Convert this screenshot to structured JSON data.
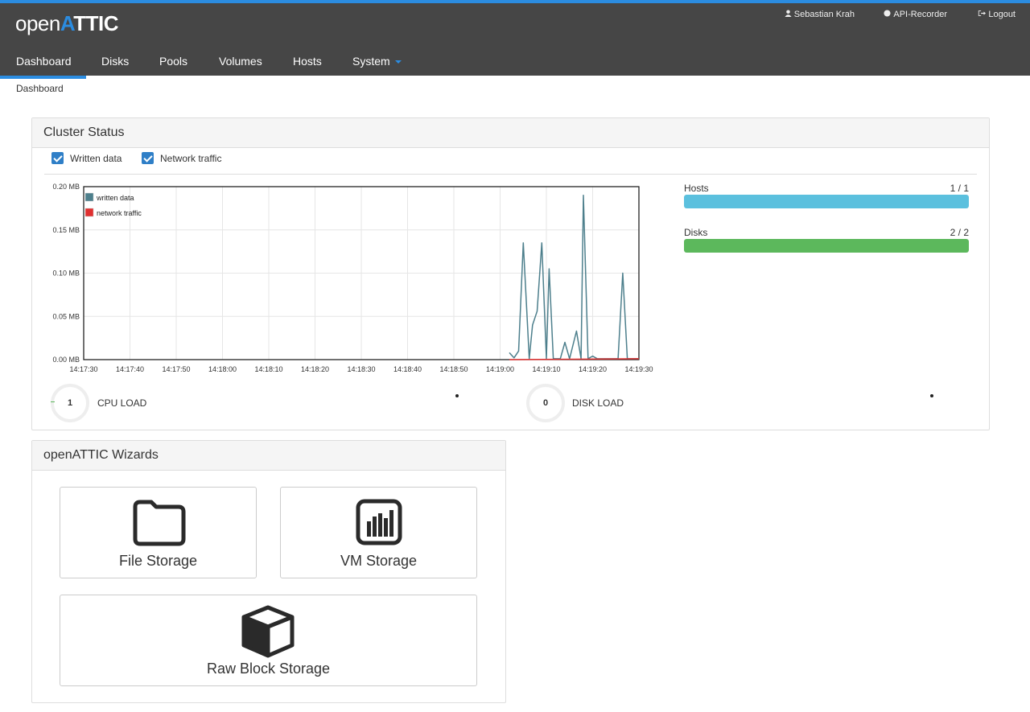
{
  "brand": {
    "prefix": "open",
    "suffix_accent": "A",
    "suffix": "TTIC"
  },
  "user_links": [
    {
      "label": "Sebastian Krah",
      "icon": "user-icon"
    },
    {
      "label": "API-Recorder",
      "icon": "record-icon"
    },
    {
      "label": "Logout",
      "icon": "logout-icon"
    }
  ],
  "nav": {
    "tabs": [
      {
        "label": "Dashboard",
        "active": true
      },
      {
        "label": "Disks"
      },
      {
        "label": "Pools"
      },
      {
        "label": "Volumes"
      },
      {
        "label": "Hosts"
      },
      {
        "label": "System",
        "dropdown": true
      }
    ]
  },
  "breadcrumb": "Dashboard",
  "cluster": {
    "title": "Cluster Status",
    "checks": [
      {
        "label": "Written data",
        "checked": true
      },
      {
        "label": "Network traffic",
        "checked": true
      }
    ],
    "stats": [
      {
        "label": "Hosts",
        "count": "1 / 1",
        "fraction": 1.0,
        "color": "#5bc0de"
      },
      {
        "label": "Disks",
        "count": "2 / 2",
        "fraction": 1.0,
        "color": "#5cb85c"
      }
    ],
    "gauges": [
      {
        "value": "1",
        "label": "CPU LOAD"
      },
      {
        "value": "0",
        "label": "DISK LOAD"
      }
    ]
  },
  "chart_data": {
    "type": "line",
    "xlabel": "",
    "ylabel": "",
    "x_ticks": [
      "14:17:30",
      "14:17:40",
      "14:17:50",
      "14:18:00",
      "14:18:10",
      "14:18:20",
      "14:18:30",
      "14:18:40",
      "14:18:50",
      "14:19:00",
      "14:19:10",
      "14:19:20",
      "14:19:30"
    ],
    "y_ticks": [
      "0.00 MB",
      "0.05 MB",
      "0.10 MB",
      "0.15 MB",
      "0.20 MB"
    ],
    "xlim_seconds_span": 120,
    "ylim": [
      0,
      0.2
    ],
    "grid": true,
    "legend_position": "top-left",
    "series": [
      {
        "name": "written data",
        "color": "#4d7f8c",
        "points": [
          [
            92,
            0.008
          ],
          [
            93,
            0.002
          ],
          [
            94,
            0.01
          ],
          [
            95,
            0.135
          ],
          [
            96.3,
            0.001
          ],
          [
            97,
            0.04
          ],
          [
            98,
            0.056
          ],
          [
            99,
            0.135
          ],
          [
            100,
            0.001
          ],
          [
            100.6,
            0.105
          ],
          [
            101.5,
            0.001
          ],
          [
            103,
            0.001
          ],
          [
            104,
            0.02
          ],
          [
            105,
            0.001
          ],
          [
            106.5,
            0.033
          ],
          [
            107.5,
            0.001
          ],
          [
            108,
            0.19
          ],
          [
            109,
            0.001
          ],
          [
            110,
            0.004
          ],
          [
            111,
            0.001
          ],
          [
            115.5,
            0.001
          ],
          [
            116.5,
            0.1
          ],
          [
            117.5,
            0.001
          ],
          [
            120,
            0.001
          ]
        ]
      },
      {
        "name": "network traffic",
        "color": "#e03030",
        "points": [
          [
            92,
            0.0
          ],
          [
            120,
            0.001
          ]
        ]
      }
    ]
  },
  "wizards": {
    "title": "openATTIC Wizards",
    "items": [
      {
        "label": "File Storage",
        "icon": "folder-icon"
      },
      {
        "label": "VM Storage",
        "icon": "bar-chart-icon"
      },
      {
        "label": "Raw Block Storage",
        "icon": "cube-icon"
      }
    ]
  }
}
